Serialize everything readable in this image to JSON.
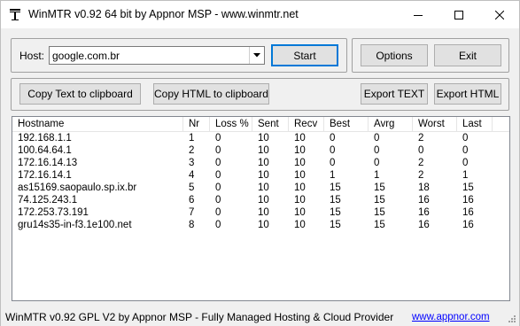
{
  "window": {
    "title": "WinMTR v0.92 64 bit by Appnor MSP - www.winmtr.net"
  },
  "host": {
    "label": "Host:",
    "value": "google.com.br"
  },
  "buttons": {
    "start": "Start",
    "options": "Options",
    "exit": "Exit",
    "copy_text": "Copy Text to clipboard",
    "copy_html": "Copy HTML to clipboard",
    "export_text": "Export TEXT",
    "export_html": "Export HTML"
  },
  "table": {
    "columns": [
      "Hostname",
      "Nr",
      "Loss %",
      "Sent",
      "Recv",
      "Best",
      "Avrg",
      "Worst",
      "Last"
    ],
    "rows": [
      [
        "192.168.1.1",
        "1",
        "0",
        "10",
        "10",
        "0",
        "0",
        "2",
        "0"
      ],
      [
        "100.64.64.1",
        "2",
        "0",
        "10",
        "10",
        "0",
        "0",
        "0",
        "0"
      ],
      [
        "172.16.14.13",
        "3",
        "0",
        "10",
        "10",
        "0",
        "0",
        "2",
        "0"
      ],
      [
        "172.16.14.1",
        "4",
        "0",
        "10",
        "10",
        "1",
        "1",
        "2",
        "1"
      ],
      [
        "as15169.saopaulo.sp.ix.br",
        "5",
        "0",
        "10",
        "10",
        "15",
        "15",
        "18",
        "15"
      ],
      [
        "74.125.243.1",
        "6",
        "0",
        "10",
        "10",
        "15",
        "15",
        "16",
        "16"
      ],
      [
        "172.253.73.191",
        "7",
        "0",
        "10",
        "10",
        "15",
        "15",
        "16",
        "16"
      ],
      [
        "gru14s35-in-f3.1e100.net",
        "8",
        "0",
        "10",
        "10",
        "15",
        "15",
        "16",
        "16"
      ]
    ]
  },
  "status": {
    "text": "WinMTR v0.92 GPL V2 by Appnor MSP - Fully Managed Hosting & Cloud Provider",
    "link": "www.appnor.com"
  },
  "icons": {
    "app": "winmtr-app-icon",
    "minimize": "minimize-icon",
    "maximize": "maximize-icon",
    "close": "close-icon",
    "dropdown": "chevron-down-icon"
  }
}
